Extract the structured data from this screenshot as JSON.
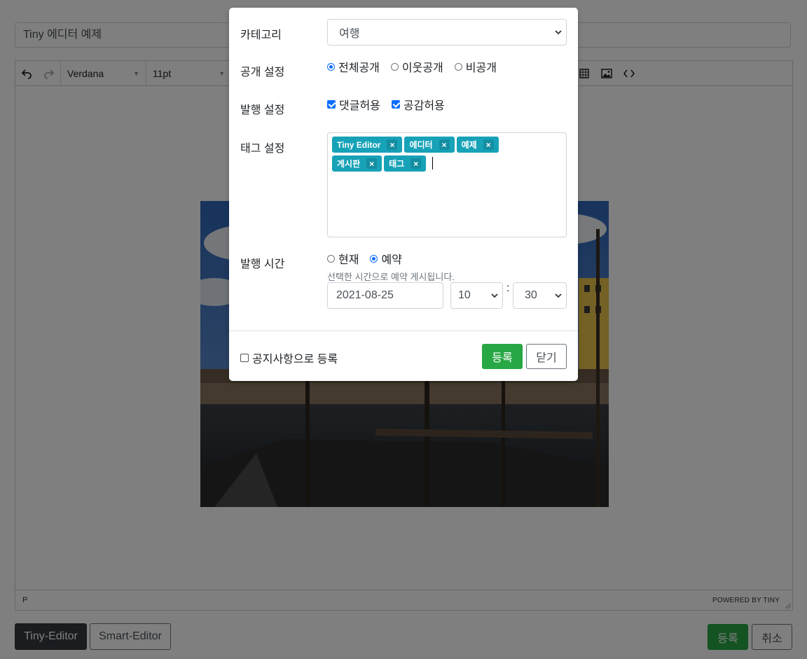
{
  "page": {
    "title_input": "Tiny 에디터 예제"
  },
  "editor": {
    "toolbar": {
      "font_family": "Verdana",
      "font_size": "11pt"
    },
    "status_path": "P",
    "powered_by": "POWERED BY TINY"
  },
  "footer": {
    "tabs": [
      "Tiny-Editor",
      "Smart-Editor"
    ],
    "submit_label": "등록",
    "cancel_label": "취소"
  },
  "modal": {
    "category": {
      "label": "카테고리",
      "value": "여행"
    },
    "visibility": {
      "label": "공개 설정",
      "options": [
        "전체공개",
        "이웃공개",
        "비공개"
      ],
      "selected": "전체공개"
    },
    "publish": {
      "label": "발행 설정",
      "options": [
        "댓글허용",
        "공감허용"
      ]
    },
    "tags": {
      "label": "태그 설정",
      "items": [
        "Tiny Editor",
        "에디터",
        "예제",
        "게시판",
        "태그"
      ],
      "remove_glyph": "×"
    },
    "publish_time": {
      "label": "발행 시간",
      "options": [
        "현재",
        "예약"
      ],
      "selected": "예약",
      "help": "선택한 시간으로 예약 게시됩니다.",
      "date": "2021-08-25",
      "hour": "10",
      "separator": ":",
      "minute": "30"
    },
    "notice_label": "공지사항으로 등록",
    "submit_label": "등록",
    "close_label": "닫기"
  }
}
